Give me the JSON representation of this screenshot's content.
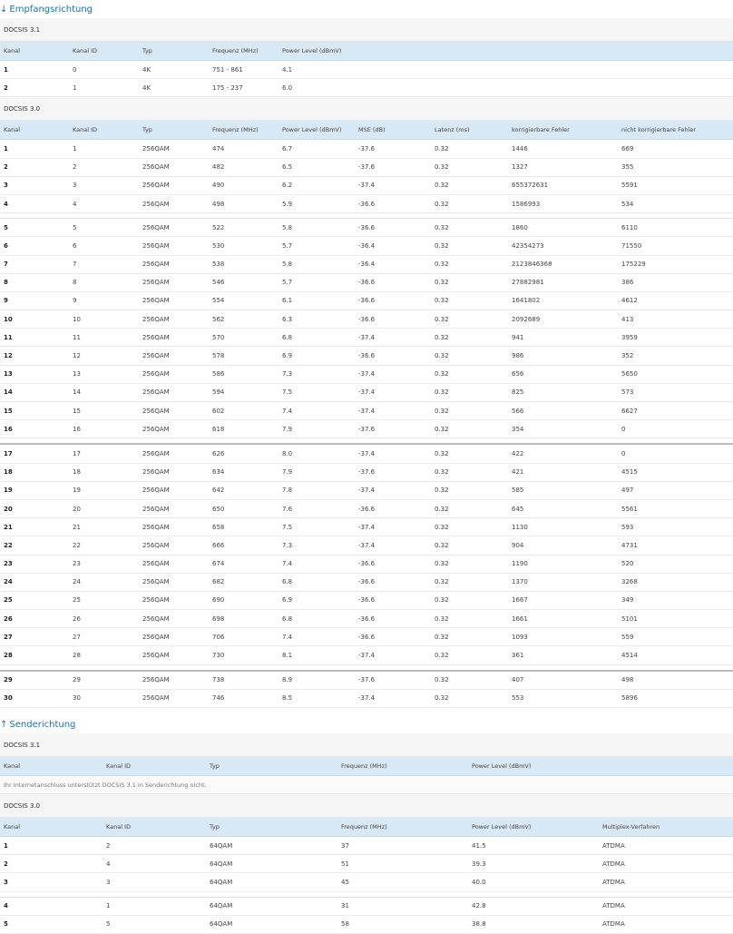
{
  "down": {
    "title": "Empfangsrichtung",
    "arrow": "↓",
    "d31": {
      "label": "DOCSIS 3.1",
      "headers": [
        "Kanal",
        "Kanal ID",
        "Typ",
        "Frequenz (MHz)",
        "Power Level (dBmV)"
      ],
      "rows": [
        [
          "1",
          "0",
          "4K",
          "751 - 861",
          "4.1"
        ],
        [
          "2",
          "1",
          "4K",
          "175 - 237",
          "6.0"
        ]
      ]
    },
    "d30": {
      "label": "DOCSIS 3.0",
      "headers": [
        "Kanal",
        "Kanal ID",
        "Typ",
        "Frequenz (MHz)",
        "Power Level (dBmV)",
        "MSE (dB)",
        "Latenz (ms)",
        "korrigierbare Fehler",
        "nicht korrigierbare Fehler"
      ],
      "rows": [
        [
          "1",
          "1",
          "256QAM",
          "474",
          "6.7",
          "-37.6",
          "0.32",
          "1446",
          "669"
        ],
        [
          "2",
          "2",
          "256QAM",
          "482",
          "6.5",
          "-37.6",
          "0.32",
          "1327",
          "355"
        ],
        [
          "3",
          "3",
          "256QAM",
          "490",
          "6.2",
          "-37.4",
          "0.32",
          "655372631",
          "5591"
        ],
        [
          "4",
          "4",
          "256QAM",
          "498",
          "5.9",
          "-36.6",
          "0.32",
          "1586993",
          "534"
        ],
        [
          "5",
          "5",
          "256QAM",
          "522",
          "5.8",
          "-36.6",
          "0.32",
          "1860",
          "6110"
        ],
        [
          "6",
          "6",
          "256QAM",
          "530",
          "5.7",
          "-36.4",
          "0.32",
          "42354273",
          "71550"
        ],
        [
          "7",
          "7",
          "256QAM",
          "538",
          "5.8",
          "-36.4",
          "0.32",
          "2123846368",
          "175229"
        ],
        [
          "8",
          "8",
          "256QAM",
          "546",
          "5.7",
          "-36.6",
          "0.32",
          "27882981",
          "386"
        ],
        [
          "9",
          "9",
          "256QAM",
          "554",
          "6.1",
          "-36.6",
          "0.32",
          "1641802",
          "4612"
        ],
        [
          "10",
          "10",
          "256QAM",
          "562",
          "6.3",
          "-36.6",
          "0.32",
          "2092689",
          "413"
        ],
        [
          "11",
          "11",
          "256QAM",
          "570",
          "6.8",
          "-37.4",
          "0.32",
          "941",
          "3959"
        ],
        [
          "12",
          "12",
          "256QAM",
          "578",
          "6.9",
          "-36.6",
          "0.32",
          "986",
          "352"
        ],
        [
          "13",
          "13",
          "256QAM",
          "586",
          "7.3",
          "-37.4",
          "0.32",
          "656",
          "5650"
        ],
        [
          "14",
          "14",
          "256QAM",
          "594",
          "7.5",
          "-37.4",
          "0.32",
          "825",
          "573"
        ],
        [
          "15",
          "15",
          "256QAM",
          "602",
          "7.4",
          "-37.4",
          "0.32",
          "566",
          "6627"
        ],
        [
          "16",
          "16",
          "256QAM",
          "618",
          "7.9",
          "-37.6",
          "0.32",
          "354",
          "0"
        ],
        [
          "17",
          "17",
          "256QAM",
          "626",
          "8.0",
          "-37.4",
          "0.32",
          "422",
          "0"
        ],
        [
          "18",
          "18",
          "256QAM",
          "634",
          "7.9",
          "-37.6",
          "0.32",
          "421",
          "4515"
        ],
        [
          "19",
          "19",
          "256QAM",
          "642",
          "7.8",
          "-37.4",
          "0.32",
          "585",
          "497"
        ],
        [
          "20",
          "20",
          "256QAM",
          "650",
          "7.6",
          "-36.6",
          "0.32",
          "645",
          "5561"
        ],
        [
          "21",
          "21",
          "256QAM",
          "658",
          "7.5",
          "-37.4",
          "0.32",
          "1130",
          "593"
        ],
        [
          "22",
          "22",
          "256QAM",
          "666",
          "7.3",
          "-37.4",
          "0.32",
          "904",
          "4731"
        ],
        [
          "23",
          "23",
          "256QAM",
          "674",
          "7.4",
          "-36.6",
          "0.32",
          "1190",
          "520"
        ],
        [
          "24",
          "24",
          "256QAM",
          "682",
          "6.8",
          "-36.6",
          "0.32",
          "1370",
          "3268"
        ],
        [
          "25",
          "25",
          "256QAM",
          "690",
          "6.9",
          "-36.6",
          "0.32",
          "1667",
          "349"
        ],
        [
          "26",
          "26",
          "256QAM",
          "698",
          "6.8",
          "-36.6",
          "0.32",
          "1661",
          "5101"
        ],
        [
          "27",
          "27",
          "256QAM",
          "706",
          "7.4",
          "-36.6",
          "0.32",
          "1093",
          "559"
        ],
        [
          "28",
          "28",
          "256QAM",
          "730",
          "8.1",
          "-37.4",
          "0.32",
          "361",
          "4514"
        ],
        [
          "29",
          "29",
          "256QAM",
          "738",
          "8.9",
          "-37.6",
          "0.32",
          "407",
          "498"
        ],
        [
          "30",
          "30",
          "256QAM",
          "746",
          "8.5",
          "-37.4",
          "0.32",
          "553",
          "5896"
        ]
      ]
    }
  },
  "up": {
    "title": "Senderichtung",
    "arrow": "↑",
    "d31": {
      "label": "DOCSIS 3.1",
      "headers": [
        "Kanal",
        "Kanal ID",
        "Typ",
        "Frequenz (MHz)",
        "Power Level (dBmV)"
      ],
      "note": "Ihr Internetanschluss unterstützt DOCSIS 3.1 in Senderichtung nicht."
    },
    "d30": {
      "label": "DOCSIS 3.0",
      "headers": [
        "Kanal",
        "Kanal ID",
        "Typ",
        "Frequenz (MHz)",
        "Power Level (dBmV)",
        "Multiplex-Verfahren"
      ],
      "rows": [
        [
          "1",
          "2",
          "64QAM",
          "37",
          "41.5",
          "ATDMA"
        ],
        [
          "2",
          "4",
          "64QAM",
          "51",
          "39.3",
          "ATDMA"
        ],
        [
          "3",
          "3",
          "64QAM",
          "45",
          "40.0",
          "ATDMA"
        ],
        [
          "4",
          "1",
          "64QAM",
          "31",
          "42.8",
          "ATDMA"
        ],
        [
          "5",
          "5",
          "64QAM",
          "58",
          "38.8",
          "ATDMA"
        ]
      ]
    }
  },
  "colors": {
    "accent": "#1f6fa8",
    "header_bg": "#d8e8f5",
    "sub_bg": "#f5f5f5"
  }
}
